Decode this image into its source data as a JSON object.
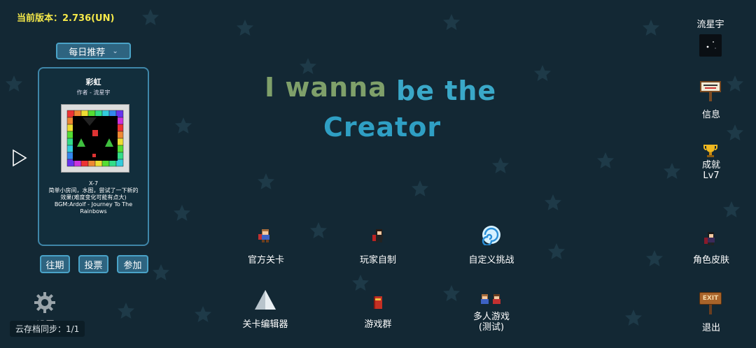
{
  "version_text": "当前版本：2.736(UN)",
  "daily": {
    "dropdown_label": "每日推荐",
    "level_title": "彩虹",
    "level_author": "作者 - 流星宇",
    "level_name": "X-7",
    "level_desc": "简单小房间，水图，尝试了一下新的效果(难度变化可能有点大)",
    "level_bgm": "BGM:Ardolf - Journey To The Rainbows",
    "buttons": [
      "往期",
      "投票",
      "参加"
    ]
  },
  "game_title": {
    "part1": "I wanna",
    "part2": "be the",
    "part3": "Creator"
  },
  "menu": {
    "official_levels": "官方关卡",
    "player_made": "玩家自制",
    "custom_challenge": "自定义挑战",
    "level_editor": "关卡编辑器",
    "game_group": "游戏群",
    "multiplayer_line1": "多人游戏",
    "multiplayer_line2": "(测试)"
  },
  "right": {
    "username": "流星宇",
    "info": "信息",
    "achievements": "成就",
    "achievement_level": "Lv7",
    "skins": "角色皮肤",
    "exit": "退出",
    "exit_sign_text": "EXIT"
  },
  "settings_label": "设置",
  "cloud_sync": "云存档同步：1/1",
  "colors": {
    "background": "#132834",
    "accent": "#4aa3c8",
    "button_bg": "#2e6480",
    "version_yellow": "#f5e94a"
  }
}
